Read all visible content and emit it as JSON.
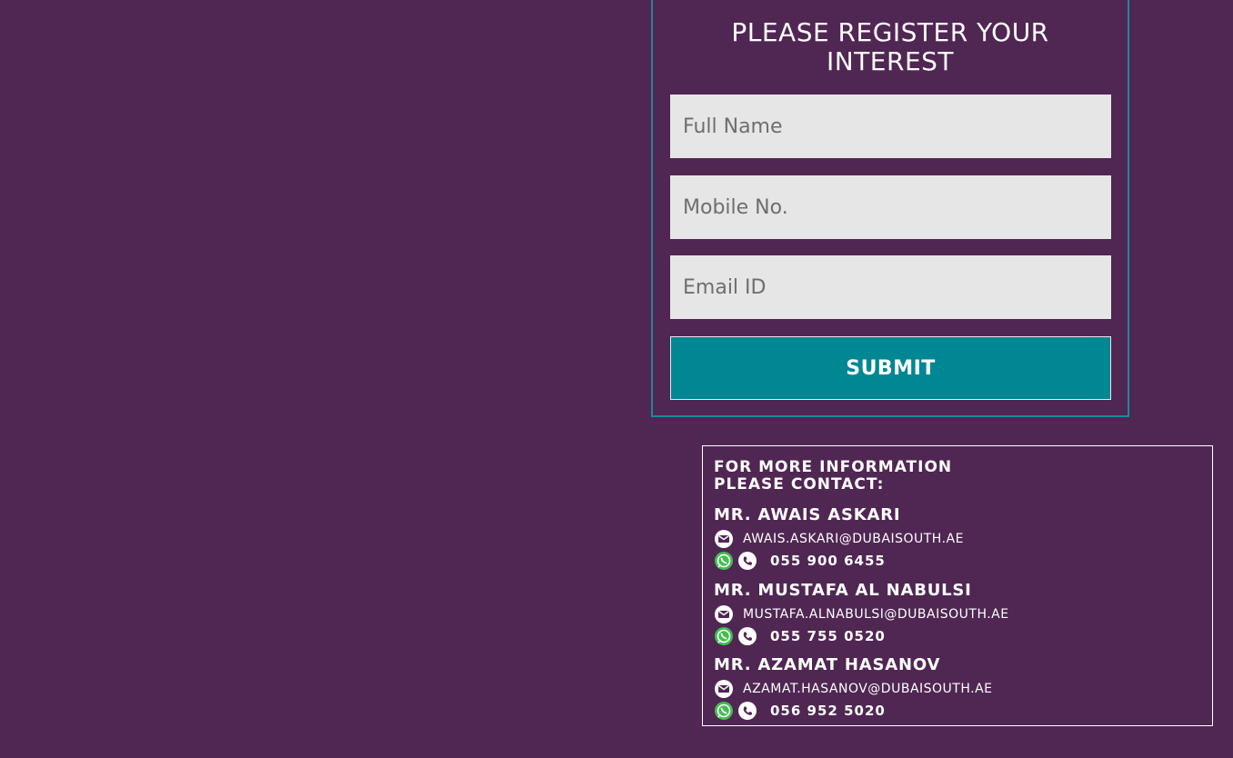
{
  "form": {
    "title": "PLEASE REGISTER YOUR INTEREST",
    "fields": {
      "full_name": {
        "placeholder": "Full Name",
        "value": ""
      },
      "mobile": {
        "placeholder": "Mobile No.",
        "value": ""
      },
      "email": {
        "placeholder": "Email ID",
        "value": ""
      }
    },
    "submit_label": "SUBMIT"
  },
  "contact": {
    "heading_line1": "FOR MORE INFORMATION",
    "heading_line2": "PLEASE CONTACT:",
    "people": [
      {
        "name": "MR. AWAIS ASKARI",
        "email": "AWAIS.ASKARI@DUBAISOUTH.AE",
        "phone": "055 900 6455"
      },
      {
        "name": "MR. MUSTAFA AL NABULSI",
        "email": "MUSTAFA.ALNABULSI@DUBAISOUTH.AE",
        "phone": "055 755 0520"
      },
      {
        "name": "MR. AZAMAT HASANOV",
        "email": "AZAMAT.HASANOV@DUBAISOUTH.AE",
        "phone": "056 952 5020"
      }
    ],
    "icons": {
      "email": "envelope-icon",
      "whatsapp": "whatsapp-icon",
      "phone": "phone-icon"
    }
  },
  "colors": {
    "background": "#502653",
    "accent": "#008794",
    "panel_border": "#1a8a99",
    "input_bg": "#e6e6e7",
    "whatsapp_green": "#3fbf4f"
  }
}
